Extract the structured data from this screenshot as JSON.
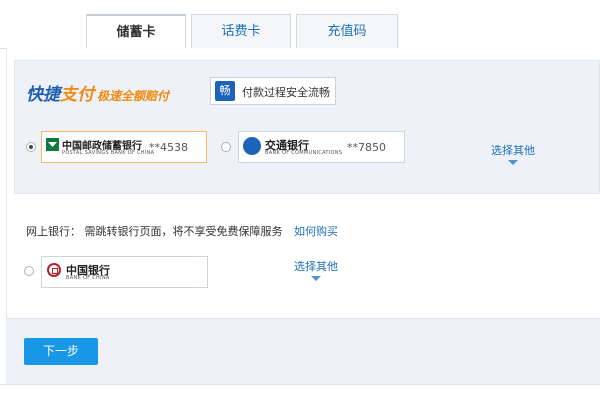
{
  "tabs": [
    {
      "label": "储蓄卡",
      "active": true
    },
    {
      "label": "话费卡",
      "active": false
    },
    {
      "label": "充值码",
      "active": false
    }
  ],
  "quickpay": {
    "logo_part1": "快捷",
    "logo_part2": "支付",
    "logo_slogan": "极速全额赔付",
    "safe_icon": "畅",
    "safe_text": "付款过程安全流畅"
  },
  "saved_cards": [
    {
      "bank_cn": "中国邮政储蓄银行",
      "bank_en": "POSTAL SAVINGS BANK OF CHINA",
      "number": "**4538",
      "selected": true
    },
    {
      "bank_cn": "交通银行",
      "bank_en": "BANK OF COMMUNICATIONS",
      "number": "**7850",
      "selected": false
    }
  ],
  "choose_other_label": "选择其他",
  "netbank": {
    "label": "网上银行：",
    "notice": "需跳转银行页面，将不享受免费保障服务",
    "link": "如何购买",
    "bank_cn": "中国银行",
    "bank_en": "BANK OF CHINA",
    "choose_other": "选择其他"
  },
  "next_button": "下一步",
  "colors": {
    "accent": "#1797e5",
    "link": "#1c6fb8",
    "orange": "#f08a12",
    "brand_blue": "#1f5fb0"
  }
}
